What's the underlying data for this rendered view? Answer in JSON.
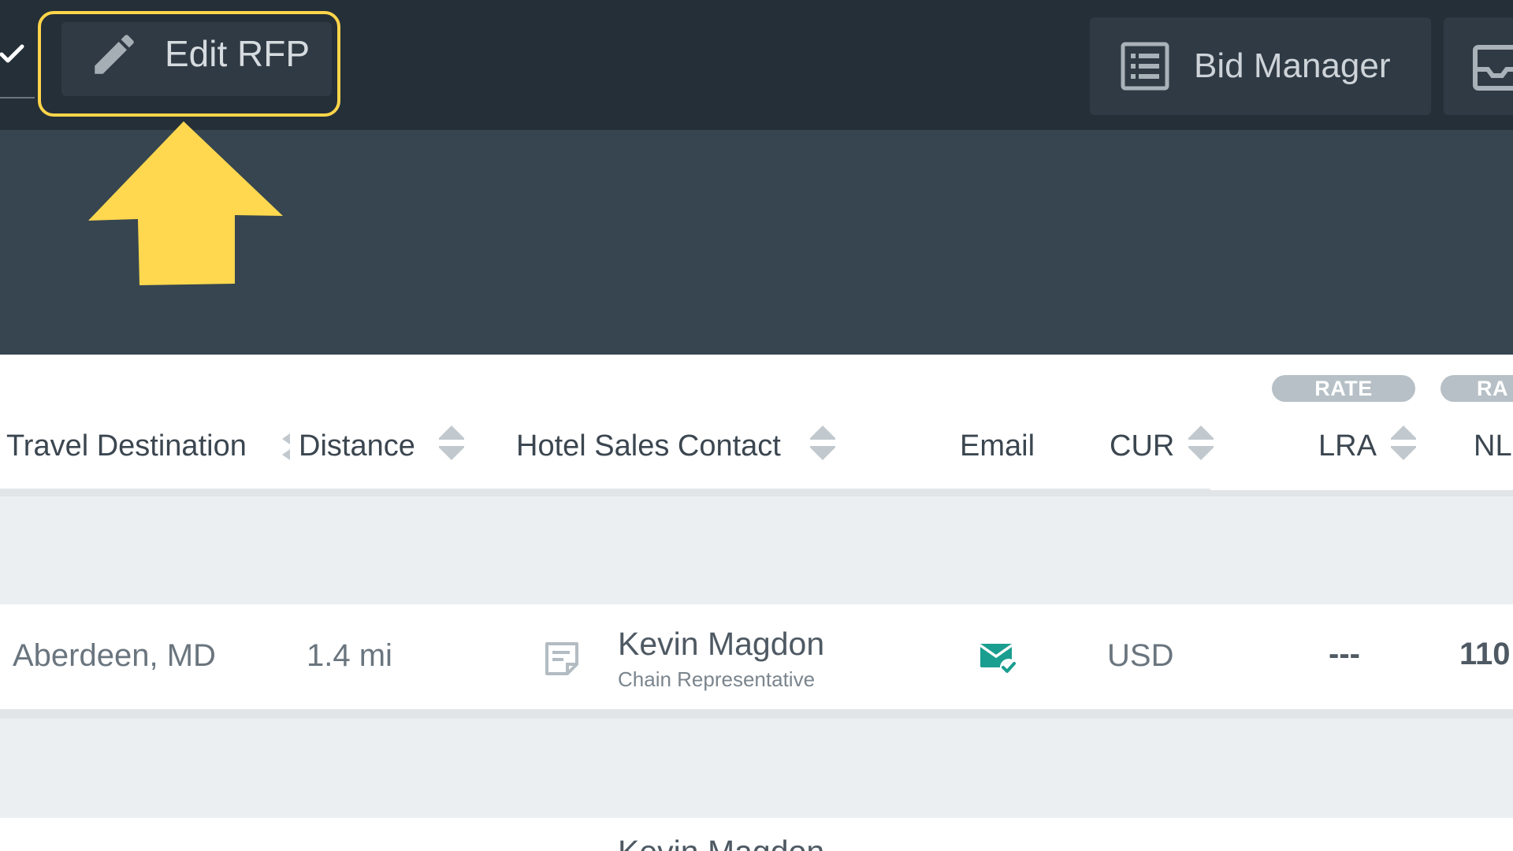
{
  "toolbar": {
    "edit_label": "Edit RFP",
    "bid_manager_label": "Bid Manager",
    "highlight_color": "#ffd54a",
    "icons": [
      "check-icon",
      "pencil-icon",
      "list-icon",
      "inbox-icon"
    ]
  },
  "table": {
    "group_labels": [
      "RATE",
      "RA"
    ],
    "columns": [
      {
        "label": "Travel Destination",
        "sortable": true
      },
      {
        "label": "Distance",
        "sortable": true
      },
      {
        "label": "Hotel Sales Contact",
        "sortable": true
      },
      {
        "label": "Email",
        "sortable": false
      },
      {
        "label": "CUR",
        "sortable": true
      },
      {
        "label": "LRA",
        "sortable": true
      },
      {
        "label": "NL",
        "sortable": false
      }
    ],
    "rows": [
      {
        "destination": "Aberdeen, MD",
        "distance": "1.4 mi",
        "contact_name": "Kevin Magdon",
        "contact_role": "Chain Representative",
        "email_status": "email-sent-icon",
        "currency": "USD",
        "lra": "---",
        "nl": "110"
      },
      {
        "contact_name": "Kevin Magdon"
      }
    ]
  },
  "colors": {
    "toolbar_bg": "#252f38",
    "band_bg": "#36454f",
    "email_icon": "#1a9e8f",
    "arrow": "#ffd84f"
  }
}
